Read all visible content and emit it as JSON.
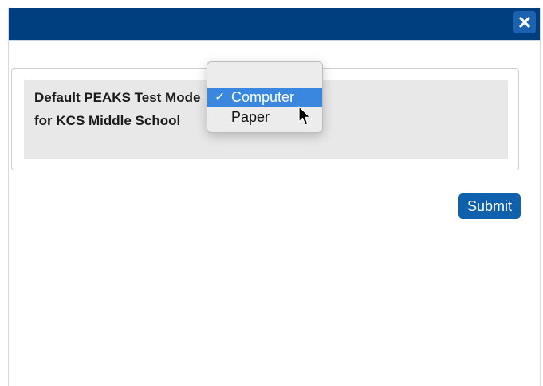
{
  "header": {
    "close_icon": "close-icon",
    "color": "#003f7f"
  },
  "form": {
    "field_label": "Default PEAKS Test Mode for KCS Middle School",
    "dropdown": {
      "selected": "Computer",
      "options": [
        {
          "label": "Computer",
          "selected": true,
          "checkmark": "✓"
        },
        {
          "label": "Paper",
          "selected": false
        }
      ]
    }
  },
  "actions": {
    "submit_label": "Submit",
    "submit_color": "#1061ad"
  }
}
